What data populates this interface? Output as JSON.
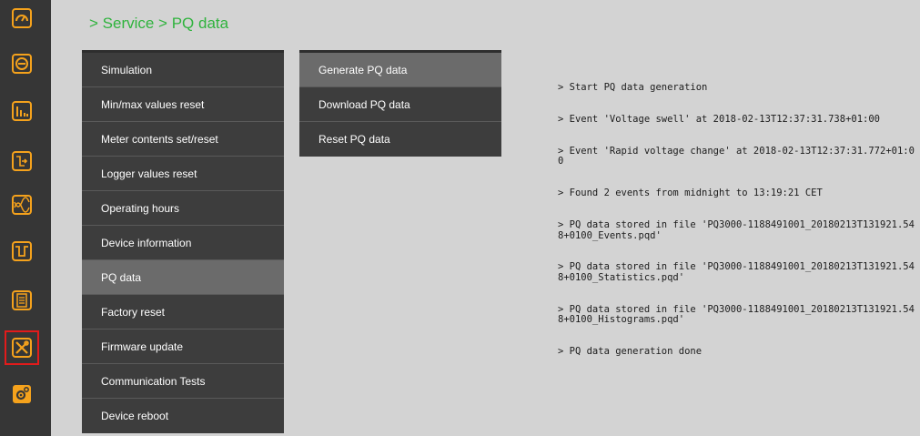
{
  "breadcrumb": "> Service > PQ data",
  "rail": {
    "icons": [
      {
        "name": "dashboard-gauge-icon",
        "color": "#f5a21c"
      },
      {
        "name": "meter-icon",
        "color": "#f5a21c"
      },
      {
        "name": "bar-chart-icon",
        "color": "#f5a21c"
      },
      {
        "name": "events-icon",
        "color": "#f5a21c"
      },
      {
        "name": "waveform-icon",
        "color": "#f5a21c"
      },
      {
        "name": "trend-icon",
        "color": "#f5a21c"
      },
      {
        "name": "logbook-icon",
        "color": "#f5a21c"
      },
      {
        "name": "service-tools-icon",
        "color": "#f5a21c",
        "active": true
      },
      {
        "name": "settings-gear-icon",
        "color": "#f5a21c"
      }
    ]
  },
  "main_menu": {
    "items": [
      {
        "label": "Simulation"
      },
      {
        "label": "Min/max values reset"
      },
      {
        "label": "Meter contents set/reset"
      },
      {
        "label": "Logger values reset"
      },
      {
        "label": "Operating hours"
      },
      {
        "label": "Device information"
      },
      {
        "label": "PQ data",
        "active": true
      },
      {
        "label": "Factory reset"
      },
      {
        "label": "Firmware update"
      },
      {
        "label": "Communication Tests"
      },
      {
        "label": "Device reboot"
      }
    ]
  },
  "sub_menu": {
    "items": [
      {
        "label": "Generate PQ data",
        "active": true
      },
      {
        "label": "Download PQ data"
      },
      {
        "label": "Reset PQ data"
      }
    ]
  },
  "log": {
    "lines": [
      "> Start PQ data generation",
      "> Event 'Voltage swell' at 2018-02-13T12:37:31.738+01:00",
      "> Event 'Rapid voltage change' at 2018-02-13T12:37:31.772+01:00",
      "> Found 2 events from midnight to 13:19:21 CET",
      "> PQ data stored in file 'PQ3000-1188491001_20180213T131921.548+0100_Events.pqd'",
      "> PQ data stored in file 'PQ3000-1188491001_20180213T131921.548+0100_Statistics.pqd'",
      "> PQ data stored in file 'PQ3000-1188491001_20180213T131921.548+0100_Histograms.pqd'",
      "> PQ data generation done"
    ]
  },
  "colors": {
    "accent": "#2fb33d",
    "rail_bg": "#363636",
    "menu_bg": "#3d3d3d",
    "menu_active": "#6b6b6b",
    "active_outline": "#e21b1b"
  }
}
